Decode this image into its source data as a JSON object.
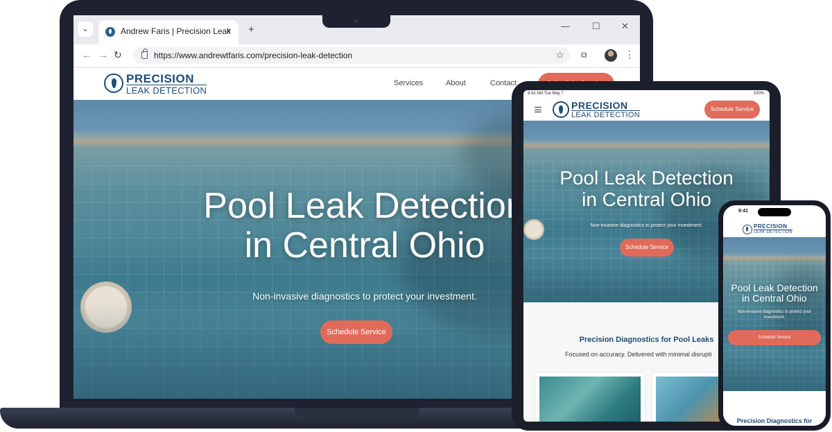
{
  "browser": {
    "tab_title": "Andrew Faris | Precision Leak",
    "tab_close": "×",
    "new_tab": "+",
    "url": "https://www.andrewtfaris.com/precision-leak-detection",
    "back": "←",
    "forward": "→",
    "reload": "↻",
    "menu": "⌄",
    "star": "☆",
    "extensions": "⧉",
    "more": "⋮",
    "minimize": "—",
    "maximize": "☐",
    "close": "✕"
  },
  "logo": {
    "word1": "PRECISION",
    "word2": "LEAK DETECTION"
  },
  "nav": {
    "services": "Services",
    "about": "About",
    "contact": "Contact",
    "cta": "Schedule Service"
  },
  "hero": {
    "title_line1": "Pool Leak Detection",
    "title_line2": "in Central Ohio",
    "subtitle": "Non-invasive diagnostics to protect your investment.",
    "cta": "Schedule Service"
  },
  "tablet": {
    "status_time": "9:41 AM  Tue May 7",
    "status_right": "100%",
    "menu_icon": "≡",
    "section_title": "Precision Diagnostics for Pool Leaks",
    "section_subtitle": "Focused on accuracy. Delivered with minimal disrupti"
  },
  "phone": {
    "time": "9:41",
    "section_title": "Precision Diagnostics for"
  },
  "colors": {
    "brand_navy": "#1e4b78",
    "cta_coral": "#e06b5a",
    "device_frame": "#1d2130"
  }
}
